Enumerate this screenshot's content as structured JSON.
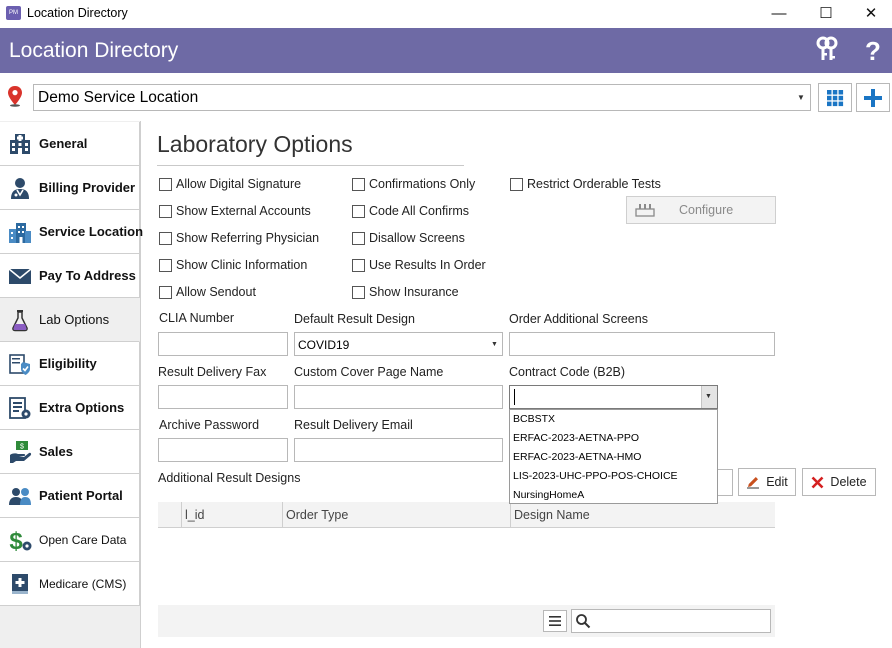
{
  "window": {
    "title": "Location Directory",
    "app_icon_text": "PM",
    "minimize_glyph": "—",
    "maximize_glyph": "☐",
    "close_glyph": "✕"
  },
  "header": {
    "title": "Location Directory",
    "keys_icon": "keys-icon",
    "help_label": "?"
  },
  "location": {
    "selected": "Demo Service Location",
    "arrow": "▼"
  },
  "sidebar": {
    "items": [
      {
        "label": "General",
        "icon": "hospital-icon"
      },
      {
        "label": "Billing Provider",
        "icon": "doctor-icon"
      },
      {
        "label": "Service Location",
        "icon": "building-icon"
      },
      {
        "label": "Pay To Address",
        "icon": "envelope-icon"
      },
      {
        "label": "Lab Options",
        "icon": "flask-icon"
      },
      {
        "label": "Eligibility",
        "icon": "shield-check-icon"
      },
      {
        "label": "Extra Options",
        "icon": "settings-list-icon"
      },
      {
        "label": "Sales",
        "icon": "money-hand-icon"
      },
      {
        "label": "Patient Portal",
        "icon": "people-icon"
      },
      {
        "label": "Open Care Data",
        "icon": "dollar-gear-icon"
      },
      {
        "label": "Medicare (CMS)",
        "icon": "medical-book-icon"
      }
    ],
    "active_index": 4
  },
  "main": {
    "title": "Laboratory Options",
    "checkboxes": {
      "col1": [
        "Allow Digital Signature",
        "Show External Accounts",
        "Show Referring Physician",
        "Show Clinic Information",
        "Allow Sendout"
      ],
      "col2": [
        "Confirmations Only",
        "Code All Confirms",
        "Disallow Screens",
        "Use Results In Order",
        "Show Insurance"
      ],
      "col3": [
        "Restrict Orderable Tests"
      ]
    },
    "configure_label": "Configure",
    "fields": {
      "clia_number": {
        "label": "CLIA Number",
        "value": ""
      },
      "default_result_design": {
        "label": "Default Result Design",
        "value": "COVID19"
      },
      "order_additional_screens": {
        "label": "Order Additional Screens",
        "value": ""
      },
      "result_delivery_fax": {
        "label": "Result Delivery Fax",
        "value": ""
      },
      "custom_cover_page_name": {
        "label": "Custom Cover Page Name",
        "value": ""
      },
      "contract_code": {
        "label": "Contract Code (B2B)",
        "value": ""
      },
      "archive_password": {
        "label": "Archive Password",
        "value": ""
      },
      "result_delivery_email": {
        "label": "Result Delivery Email",
        "value": ""
      }
    },
    "contract_code_options": [
      "BCBSTX",
      "ERFAC-2023-AETNA-PPO",
      "ERFAC-2023-AETNA-HMO",
      "LIS-2023-UHC-PPO-POS-CHOICE",
      "NursingHomeA"
    ],
    "additional_result_designs_label": "Additional Result Designs",
    "edit_label": "Edit",
    "delete_label": "Delete",
    "grid_columns": [
      "l_id",
      "Order Type",
      "Design Name"
    ],
    "grid_rows": []
  },
  "colors": {
    "header_bg": "#6e6aa5",
    "accent_blue": "#1a75c4",
    "delete_red": "#d42020",
    "edit_orange": "#c8501e"
  }
}
